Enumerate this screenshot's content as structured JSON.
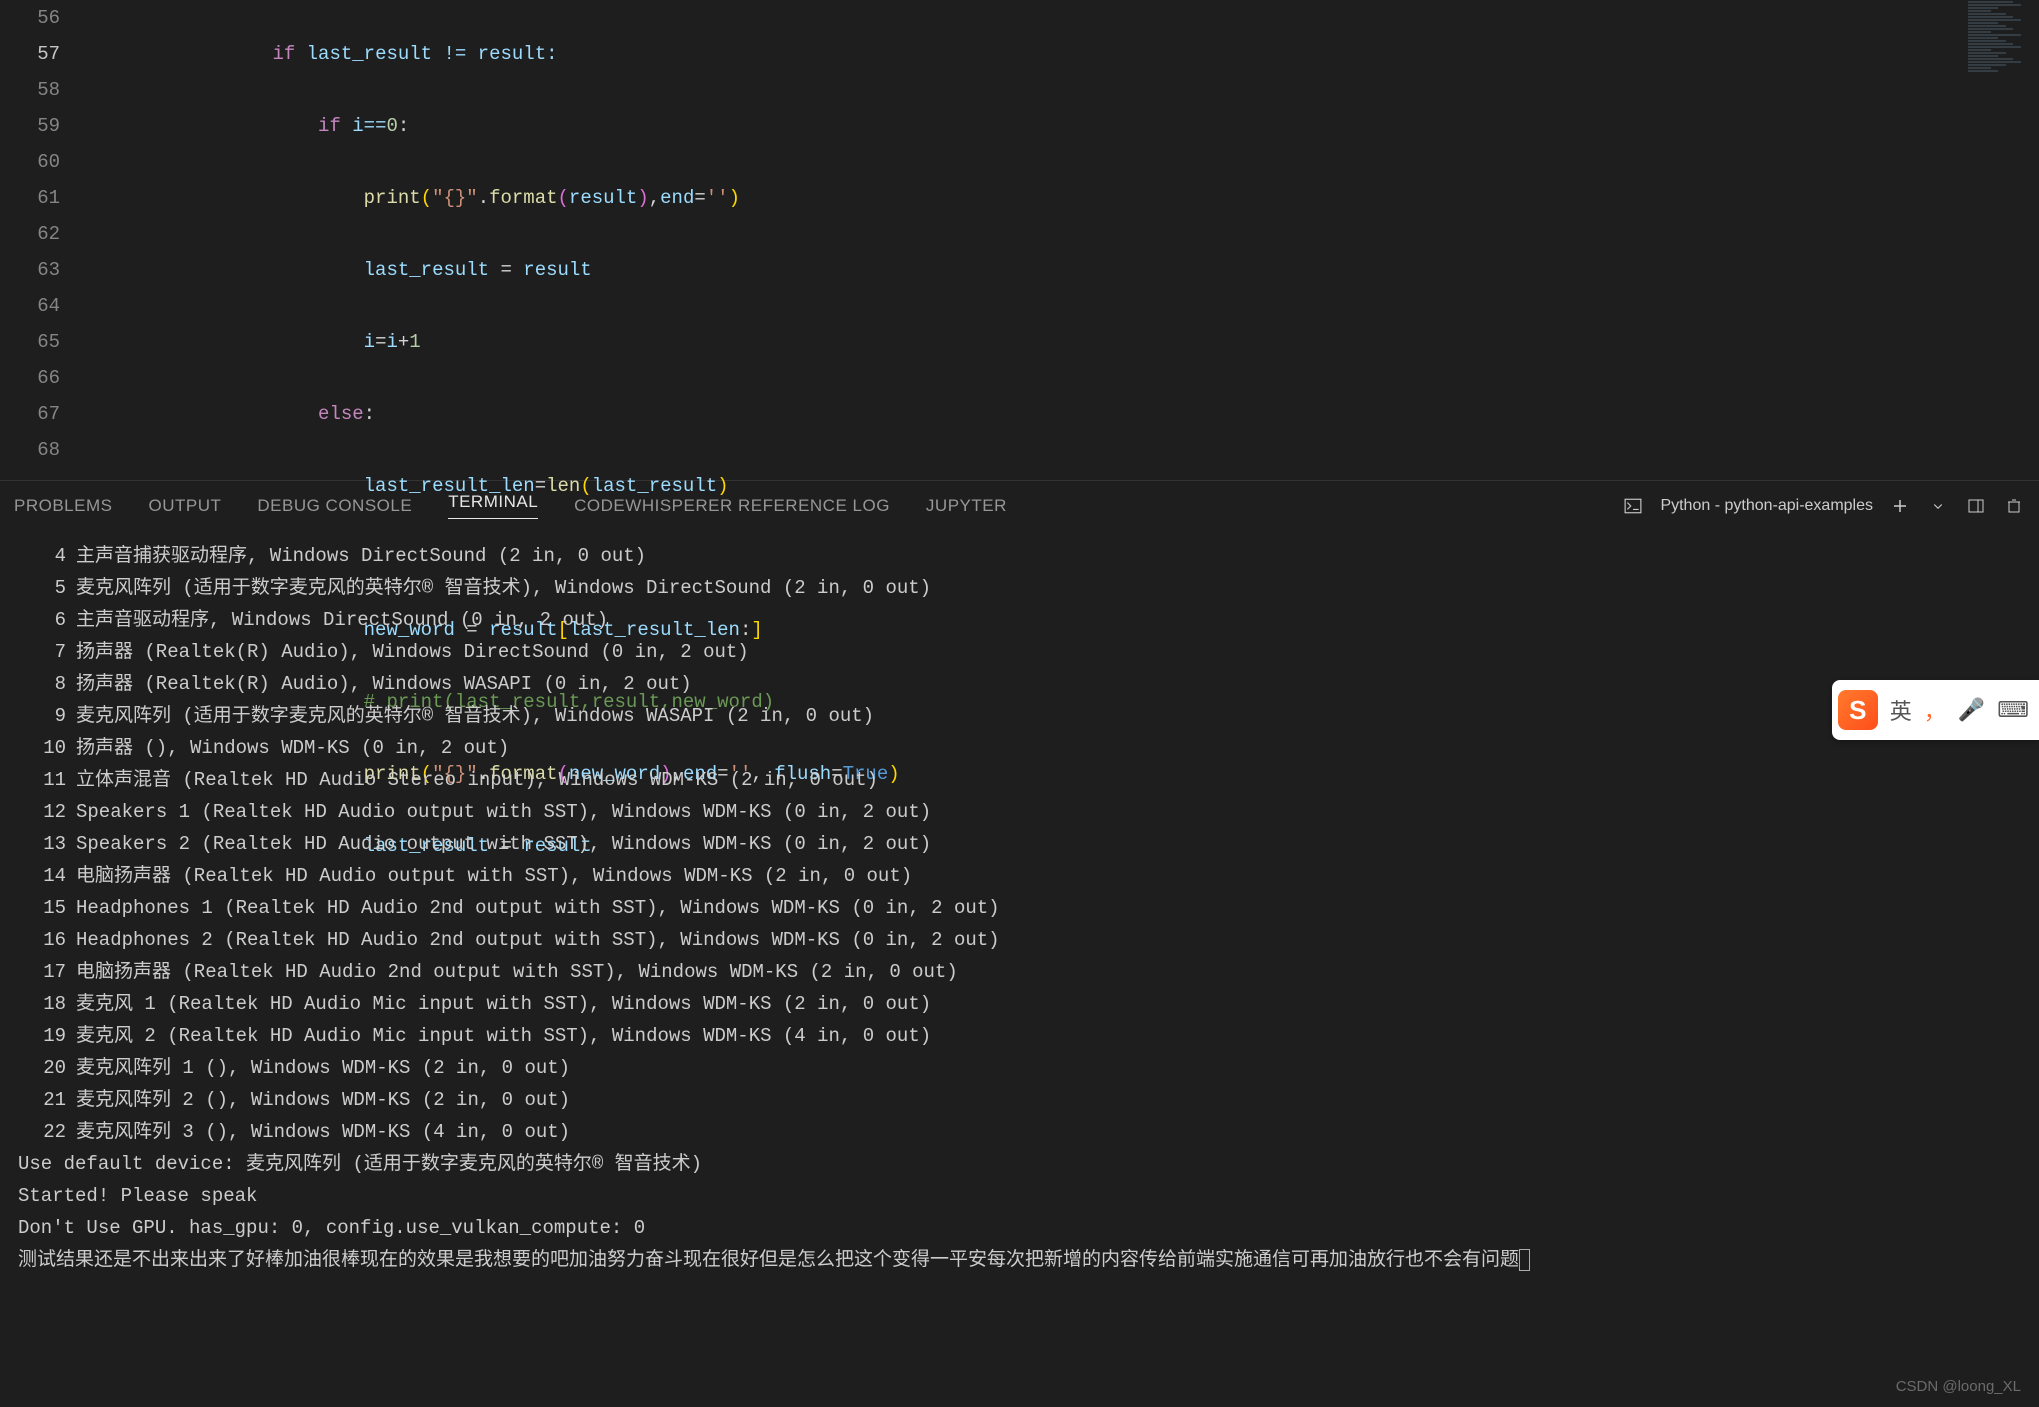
{
  "editor": {
    "line_numbers": [
      "56",
      "57",
      "58",
      "59",
      "60",
      "61",
      "62",
      "63",
      "64",
      "65",
      "66",
      "67",
      "68"
    ],
    "current_line_index": 1,
    "lines": {
      "l56": {
        "indent": "                ",
        "kw": "if",
        "rest": " last_result != result:"
      },
      "l57": {
        "indent": "                    ",
        "kw": "if",
        "cond": " i==",
        "num": "0",
        "colon": ":"
      },
      "l58": {
        "indent": "                        ",
        "fn": "print",
        "open": "(",
        "str1": "\"{}\"",
        "dot": ".",
        "fmt": "format",
        "open2": "(",
        "arg": "result",
        "close2": ")",
        "comma": ",",
        "kwarg": "end",
        "eq": "=",
        "str2": "''",
        "close": ")"
      },
      "l59": {
        "indent": "                        ",
        "lhs": "last_result",
        "rhs": "result"
      },
      "l60": {
        "indent": "                        ",
        "lhs": "i",
        "eq": "=",
        "rhs1": "i",
        "plus": "+",
        "num": "1"
      },
      "l61": {
        "indent": "                    ",
        "kw": "else",
        "colon": ":"
      },
      "l62": {
        "indent": "                        ",
        "lhs": "last_result_len",
        "eq": "=",
        "fn": "len",
        "open": "(",
        "arg": "last_result",
        "close": ")"
      },
      "l63": "",
      "l64": {
        "indent": "                        ",
        "lhs": "new_word",
        "rhs": "result",
        "open": "[",
        "slice": "last_result_len",
        ":": ":",
        "close": "]"
      },
      "l65": {
        "indent": "                        ",
        "comment": "# print(last_result,result,new_word)"
      },
      "l66": {
        "indent": "                        ",
        "fn": "print",
        "open": "(",
        "str1": "\"{}\"",
        "dot": ".",
        "fmt": "format",
        "open2": "(",
        "arg": "new_word",
        "close2": ")",
        "comma": ",",
        "kwarg": "end",
        "eq": "=",
        "str2": "''",
        "comma2": ", ",
        "kwarg2": "flush",
        "eq2": "=",
        "true": "True",
        "close": ")"
      },
      "l67": {
        "indent": "                        ",
        "lhs": "last_result",
        "rhs": "result"
      },
      "l68": ""
    }
  },
  "panel": {
    "tabs": [
      "PROBLEMS",
      "OUTPUT",
      "DEBUG CONSOLE",
      "TERMINAL",
      "CODEWHISPERER REFERENCE LOG",
      "JUPYTER"
    ],
    "active_tab": "TERMINAL",
    "shell_label": "Python - python-api-examples"
  },
  "terminal": {
    "numbered": [
      {
        "n": "4",
        "t": "主声音捕获驱动程序, Windows DirectSound (2 in, 0 out)"
      },
      {
        "n": "5",
        "t": "麦克风阵列 (适用于数字麦克风的英特尔® 智音技术), Windows DirectSound (2 in, 0 out)"
      },
      {
        "n": "6",
        "t": "主声音驱动程序, Windows DirectSound (0 in, 2 out)"
      },
      {
        "n": "7",
        "t": "扬声器 (Realtek(R) Audio), Windows DirectSound (0 in, 2 out)"
      },
      {
        "n": "8",
        "t": "扬声器 (Realtek(R) Audio), Windows WASAPI (0 in, 2 out)"
      },
      {
        "n": "9",
        "t": "麦克风阵列 (适用于数字麦克风的英特尔® 智音技术), Windows WASAPI (2 in, 0 out)"
      },
      {
        "n": "10",
        "t": "扬声器 (), Windows WDM-KS (0 in, 2 out)"
      },
      {
        "n": "11",
        "t": "立体声混音 (Realtek HD Audio Stereo input), Windows WDM-KS (2 in, 0 out)"
      },
      {
        "n": "12",
        "t": "Speakers 1 (Realtek HD Audio output with SST), Windows WDM-KS (0 in, 2 out)"
      },
      {
        "n": "13",
        "t": "Speakers 2 (Realtek HD Audio output with SST), Windows WDM-KS (0 in, 2 out)"
      },
      {
        "n": "14",
        "t": "电脑扬声器 (Realtek HD Audio output with SST), Windows WDM-KS (2 in, 0 out)"
      },
      {
        "n": "15",
        "t": "Headphones 1 (Realtek HD Audio 2nd output with SST), Windows WDM-KS (0 in, 2 out)"
      },
      {
        "n": "16",
        "t": "Headphones 2 (Realtek HD Audio 2nd output with SST), Windows WDM-KS (0 in, 2 out)"
      },
      {
        "n": "17",
        "t": "电脑扬声器 (Realtek HD Audio 2nd output with SST), Windows WDM-KS (2 in, 0 out)"
      },
      {
        "n": "18",
        "t": "麦克风 1 (Realtek HD Audio Mic input with SST), Windows WDM-KS (2 in, 0 out)"
      },
      {
        "n": "19",
        "t": "麦克风 2 (Realtek HD Audio Mic input with SST), Windows WDM-KS (4 in, 0 out)"
      },
      {
        "n": "20",
        "t": "麦克风阵列 1 (), Windows WDM-KS (2 in, 0 out)"
      },
      {
        "n": "21",
        "t": "麦克风阵列 2 (), Windows WDM-KS (2 in, 0 out)"
      },
      {
        "n": "22",
        "t": "麦克风阵列 3 (), Windows WDM-KS (4 in, 0 out)"
      }
    ],
    "free": [
      "Use default device: 麦克风阵列 (适用于数字麦克风的英特尔® 智音技术)",
      "Started! Please speak",
      "Don't Use GPU. has_gpu: 0, config.use_vulkan_compute: 0",
      "测试结果还是不出来出来了好棒加油很棒现在的效果是我想要的吧加油努力奋斗现在很好但是怎么把这个变得一平安每次把新增的内容传给前端实施通信可再加油放行也不会有问题"
    ]
  },
  "ime": {
    "logo": "S",
    "lang": "英",
    "punct": "，",
    "mic": "🎤",
    "kb": "⌨"
  },
  "watermark": "CSDN @loong_XL"
}
